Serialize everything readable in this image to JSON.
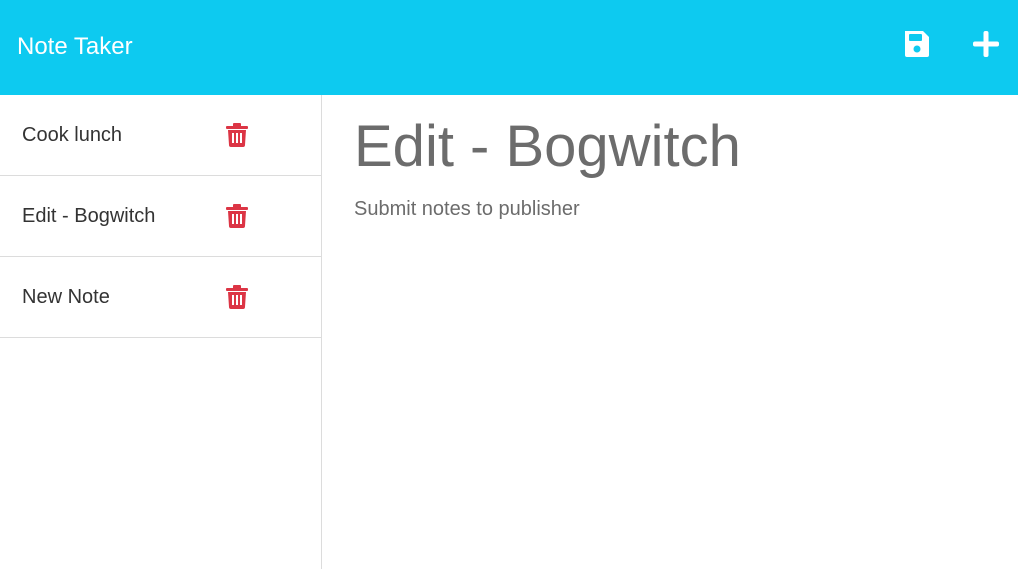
{
  "app": {
    "title": "Note Taker"
  },
  "toolbar": {
    "save_icon": "save-icon",
    "new_icon": "plus-icon"
  },
  "colors": {
    "navbar": "#0dcaf0",
    "delete": "#dc3545"
  },
  "notes": [
    {
      "title": "Cook lunch",
      "icon": "trash-icon"
    },
    {
      "title": "Edit - Bogwitch",
      "icon": "trash-icon"
    },
    {
      "title": "New Note",
      "icon": "trash-icon"
    }
  ],
  "editor": {
    "title": "Edit - Bogwitch",
    "text": "Submit notes to publisher"
  }
}
